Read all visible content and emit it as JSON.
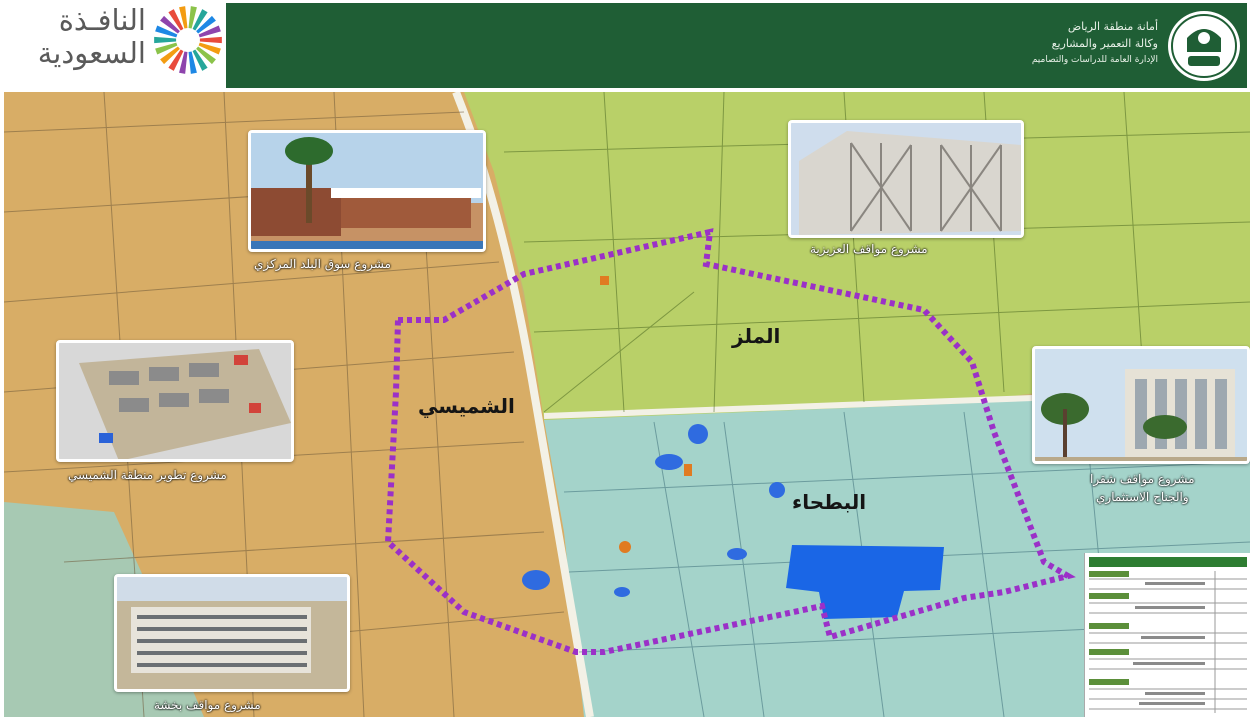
{
  "brand": {
    "text": "النافـذة السعودية",
    "line1": "النافـذة",
    "line2": "السعودية",
    "colors": [
      "#e84b3c",
      "#f39c12",
      "#8bc34a",
      "#26a69a",
      "#1e88e5",
      "#8e44ad"
    ]
  },
  "header": {
    "org_line1": "أمانة منطقة الرياض",
    "org_line2": "وكالة التعمير والمشاريع",
    "org_line3": "الإدارة العامة للدراسات والتصاميم",
    "seal_icon": "riyadh-municipality-seal",
    "band_color": "#1f5e35"
  },
  "map": {
    "districts": [
      {
        "id": "almalaz",
        "name": "الملز"
      },
      {
        "id": "alshumaisi",
        "name": "الشميسي"
      },
      {
        "id": "albatha",
        "name": "البطحاء"
      }
    ],
    "boundary_color": "#9b30c8",
    "zone_colors": {
      "west": "#d9a863",
      "north": "#b8d06a",
      "south": "#9fd0c8"
    }
  },
  "projects": [
    {
      "id": "central-market",
      "caption": "مشروع سوق البلد المركزي"
    },
    {
      "id": "aziziyah-parking",
      "caption": "مشروع مواقف العزيزية"
    },
    {
      "id": "shumaisi-development",
      "caption": "مشروع تطوير منطقة الشميسي"
    },
    {
      "id": "qura-parking",
      "caption_line1": "مشروع مواقف شقرا",
      "caption_line2": "والجناح الاستثماري"
    },
    {
      "id": "bottom-left",
      "caption": "مشروع مواقف بخشة"
    }
  ]
}
